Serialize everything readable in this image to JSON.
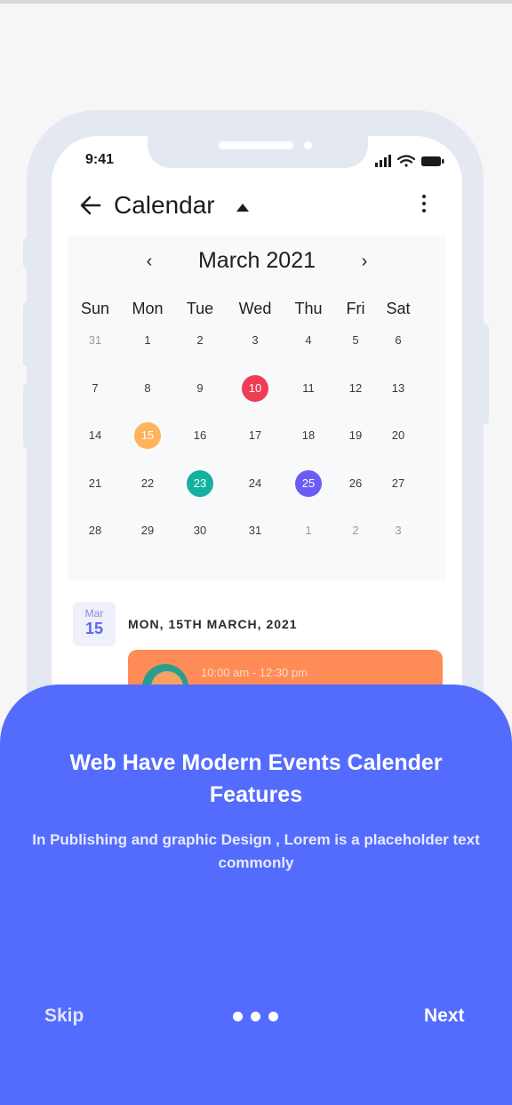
{
  "phone": {
    "status_time": "9:41",
    "header": {
      "title": "Calendar"
    },
    "calendar": {
      "month_label": "March 2021",
      "prev_label": "‹",
      "next_label": "›",
      "weekdays": [
        "Sun",
        "Mon",
        "Tue",
        "Wed",
        "Thu",
        "Fri",
        "Sat"
      ],
      "weeks": [
        [
          {
            "d": "31",
            "m": true
          },
          {
            "d": "1"
          },
          {
            "d": "2"
          },
          {
            "d": "3"
          },
          {
            "d": "4"
          },
          {
            "d": "5"
          },
          {
            "d": "6"
          }
        ],
        [
          {
            "d": "7"
          },
          {
            "d": "8"
          },
          {
            "d": "9"
          },
          {
            "d": "10",
            "c": "#ee3d55"
          },
          {
            "d": "11"
          },
          {
            "d": "12"
          },
          {
            "d": "13"
          }
        ],
        [
          {
            "d": "14"
          },
          {
            "d": "15",
            "c": "#ffb35c"
          },
          {
            "d": "16"
          },
          {
            "d": "17"
          },
          {
            "d": "18"
          },
          {
            "d": "19"
          },
          {
            "d": "20"
          }
        ],
        [
          {
            "d": "21"
          },
          {
            "d": "22"
          },
          {
            "d": "23",
            "c": "#12b2a0"
          },
          {
            "d": "24"
          },
          {
            "d": "25",
            "c": "#6b5cf6"
          },
          {
            "d": "26"
          },
          {
            "d": "27"
          }
        ],
        [
          {
            "d": "28"
          },
          {
            "d": "29"
          },
          {
            "d": "30"
          },
          {
            "d": "31"
          },
          {
            "d": "1",
            "m": true
          },
          {
            "d": "2",
            "m": true
          },
          {
            "d": "3",
            "m": true
          }
        ]
      ]
    },
    "date_badge": {
      "month": "Mar",
      "day": "15"
    },
    "selected_date_text": "MON, 15TH MARCH, 2021",
    "event": {
      "time": "10:00 am - 12:30 pm"
    }
  },
  "onboarding": {
    "title": "Web Have Modern Events Calender Features",
    "description": "In Publishing and graphic Design , Lorem is a placeholder text commonly",
    "skip_label": "Skip",
    "next_label": "Next",
    "page_count": 3
  },
  "colors": {
    "sheet": "#536cfe",
    "event_card": "#ff8c57",
    "accent_purple": "#5b66f0"
  }
}
